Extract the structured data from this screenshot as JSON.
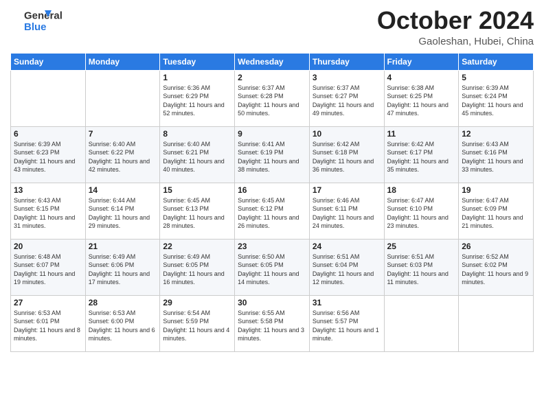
{
  "logo": {
    "line1": "General",
    "line2": "Blue"
  },
  "header": {
    "month": "October 2024",
    "location": "Gaoleshan, Hubei, China"
  },
  "days_of_week": [
    "Sunday",
    "Monday",
    "Tuesday",
    "Wednesday",
    "Thursday",
    "Friday",
    "Saturday"
  ],
  "weeks": [
    [
      {
        "day": "",
        "sunrise": "",
        "sunset": "",
        "daylight": ""
      },
      {
        "day": "",
        "sunrise": "",
        "sunset": "",
        "daylight": ""
      },
      {
        "day": "1",
        "sunrise": "Sunrise: 6:36 AM",
        "sunset": "Sunset: 6:29 PM",
        "daylight": "Daylight: 11 hours and 52 minutes."
      },
      {
        "day": "2",
        "sunrise": "Sunrise: 6:37 AM",
        "sunset": "Sunset: 6:28 PM",
        "daylight": "Daylight: 11 hours and 50 minutes."
      },
      {
        "day": "3",
        "sunrise": "Sunrise: 6:37 AM",
        "sunset": "Sunset: 6:27 PM",
        "daylight": "Daylight: 11 hours and 49 minutes."
      },
      {
        "day": "4",
        "sunrise": "Sunrise: 6:38 AM",
        "sunset": "Sunset: 6:25 PM",
        "daylight": "Daylight: 11 hours and 47 minutes."
      },
      {
        "day": "5",
        "sunrise": "Sunrise: 6:39 AM",
        "sunset": "Sunset: 6:24 PM",
        "daylight": "Daylight: 11 hours and 45 minutes."
      }
    ],
    [
      {
        "day": "6",
        "sunrise": "Sunrise: 6:39 AM",
        "sunset": "Sunset: 6:23 PM",
        "daylight": "Daylight: 11 hours and 43 minutes."
      },
      {
        "day": "7",
        "sunrise": "Sunrise: 6:40 AM",
        "sunset": "Sunset: 6:22 PM",
        "daylight": "Daylight: 11 hours and 42 minutes."
      },
      {
        "day": "8",
        "sunrise": "Sunrise: 6:40 AM",
        "sunset": "Sunset: 6:21 PM",
        "daylight": "Daylight: 11 hours and 40 minutes."
      },
      {
        "day": "9",
        "sunrise": "Sunrise: 6:41 AM",
        "sunset": "Sunset: 6:19 PM",
        "daylight": "Daylight: 11 hours and 38 minutes."
      },
      {
        "day": "10",
        "sunrise": "Sunrise: 6:42 AM",
        "sunset": "Sunset: 6:18 PM",
        "daylight": "Daylight: 11 hours and 36 minutes."
      },
      {
        "day": "11",
        "sunrise": "Sunrise: 6:42 AM",
        "sunset": "Sunset: 6:17 PM",
        "daylight": "Daylight: 11 hours and 35 minutes."
      },
      {
        "day": "12",
        "sunrise": "Sunrise: 6:43 AM",
        "sunset": "Sunset: 6:16 PM",
        "daylight": "Daylight: 11 hours and 33 minutes."
      }
    ],
    [
      {
        "day": "13",
        "sunrise": "Sunrise: 6:43 AM",
        "sunset": "Sunset: 6:15 PM",
        "daylight": "Daylight: 11 hours and 31 minutes."
      },
      {
        "day": "14",
        "sunrise": "Sunrise: 6:44 AM",
        "sunset": "Sunset: 6:14 PM",
        "daylight": "Daylight: 11 hours and 29 minutes."
      },
      {
        "day": "15",
        "sunrise": "Sunrise: 6:45 AM",
        "sunset": "Sunset: 6:13 PM",
        "daylight": "Daylight: 11 hours and 28 minutes."
      },
      {
        "day": "16",
        "sunrise": "Sunrise: 6:45 AM",
        "sunset": "Sunset: 6:12 PM",
        "daylight": "Daylight: 11 hours and 26 minutes."
      },
      {
        "day": "17",
        "sunrise": "Sunrise: 6:46 AM",
        "sunset": "Sunset: 6:11 PM",
        "daylight": "Daylight: 11 hours and 24 minutes."
      },
      {
        "day": "18",
        "sunrise": "Sunrise: 6:47 AM",
        "sunset": "Sunset: 6:10 PM",
        "daylight": "Daylight: 11 hours and 23 minutes."
      },
      {
        "day": "19",
        "sunrise": "Sunrise: 6:47 AM",
        "sunset": "Sunset: 6:09 PM",
        "daylight": "Daylight: 11 hours and 21 minutes."
      }
    ],
    [
      {
        "day": "20",
        "sunrise": "Sunrise: 6:48 AM",
        "sunset": "Sunset: 6:07 PM",
        "daylight": "Daylight: 11 hours and 19 minutes."
      },
      {
        "day": "21",
        "sunrise": "Sunrise: 6:49 AM",
        "sunset": "Sunset: 6:06 PM",
        "daylight": "Daylight: 11 hours and 17 minutes."
      },
      {
        "day": "22",
        "sunrise": "Sunrise: 6:49 AM",
        "sunset": "Sunset: 6:05 PM",
        "daylight": "Daylight: 11 hours and 16 minutes."
      },
      {
        "day": "23",
        "sunrise": "Sunrise: 6:50 AM",
        "sunset": "Sunset: 6:05 PM",
        "daylight": "Daylight: 11 hours and 14 minutes."
      },
      {
        "day": "24",
        "sunrise": "Sunrise: 6:51 AM",
        "sunset": "Sunset: 6:04 PM",
        "daylight": "Daylight: 11 hours and 12 minutes."
      },
      {
        "day": "25",
        "sunrise": "Sunrise: 6:51 AM",
        "sunset": "Sunset: 6:03 PM",
        "daylight": "Daylight: 11 hours and 11 minutes."
      },
      {
        "day": "26",
        "sunrise": "Sunrise: 6:52 AM",
        "sunset": "Sunset: 6:02 PM",
        "daylight": "Daylight: 11 hours and 9 minutes."
      }
    ],
    [
      {
        "day": "27",
        "sunrise": "Sunrise: 6:53 AM",
        "sunset": "Sunset: 6:01 PM",
        "daylight": "Daylight: 11 hours and 8 minutes."
      },
      {
        "day": "28",
        "sunrise": "Sunrise: 6:53 AM",
        "sunset": "Sunset: 6:00 PM",
        "daylight": "Daylight: 11 hours and 6 minutes."
      },
      {
        "day": "29",
        "sunrise": "Sunrise: 6:54 AM",
        "sunset": "Sunset: 5:59 PM",
        "daylight": "Daylight: 11 hours and 4 minutes."
      },
      {
        "day": "30",
        "sunrise": "Sunrise: 6:55 AM",
        "sunset": "Sunset: 5:58 PM",
        "daylight": "Daylight: 11 hours and 3 minutes."
      },
      {
        "day": "31",
        "sunrise": "Sunrise: 6:56 AM",
        "sunset": "Sunset: 5:57 PM",
        "daylight": "Daylight: 11 hours and 1 minute."
      },
      {
        "day": "",
        "sunrise": "",
        "sunset": "",
        "daylight": ""
      },
      {
        "day": "",
        "sunrise": "",
        "sunset": "",
        "daylight": ""
      }
    ]
  ]
}
